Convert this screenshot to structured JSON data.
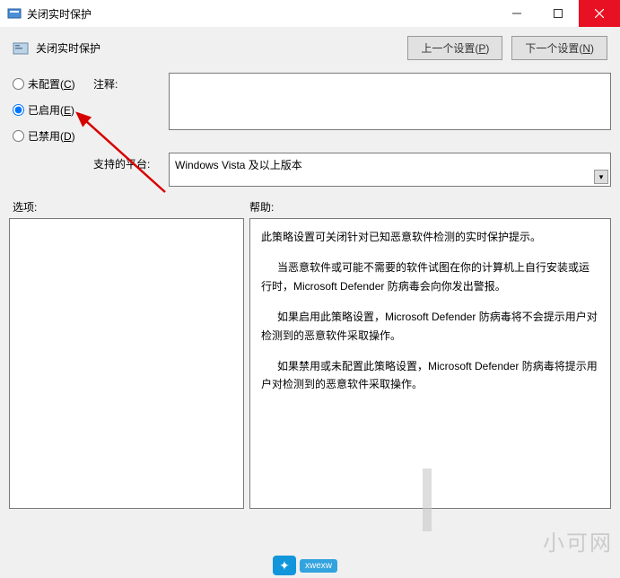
{
  "window": {
    "title": "关闭实时保护"
  },
  "subheader": {
    "title": "关闭实时保护"
  },
  "nav": {
    "prev": "上一个设置(<u>P</u>)",
    "next": "下一个设置(<u>N</u>)"
  },
  "state": {
    "not_configured": "未配置(<u>C</u>)",
    "enabled": "已启用(<u>E</u>)",
    "disabled": "已禁用(<u>D</u>)",
    "selected": "enabled"
  },
  "labels": {
    "comment": "注释:",
    "platform": "支持的平台:",
    "options": "选项:",
    "help": "帮助:"
  },
  "fields": {
    "comment_value": "",
    "platform_value": "Windows Vista 及以上版本"
  },
  "help": {
    "p1": "此策略设置可关闭针对已知恶意软件检测的实时保护提示。",
    "p2": "当恶意软件或可能不需要的软件试图在你的计算机上自行安装或运行时，Microsoft Defender 防病毒会向你发出警报。",
    "p3": "如果启用此策略设置，Microsoft Defender 防病毒将不会提示用户对检测到的恶意软件采取操作。",
    "p4": "如果禁用或未配置此策略设置，Microsoft Defender 防病毒将提示用户对检测到的恶意软件采取操作。"
  },
  "watermark": "小可网"
}
